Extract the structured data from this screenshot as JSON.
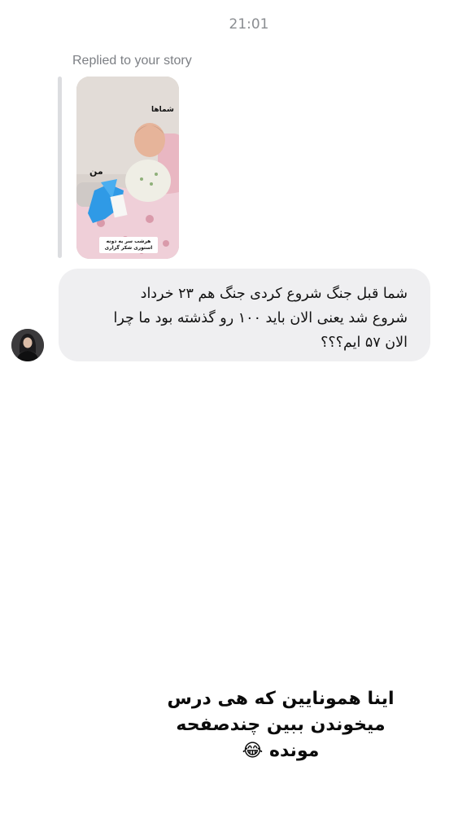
{
  "header": {
    "time": "21:01"
  },
  "story_reply": {
    "label": "Replied to your story",
    "thumbnail": {
      "top_tag": "شماها",
      "side_tag": "من",
      "caption": "هرشب سر یه دونه استوری شکر گزاری"
    }
  },
  "message": {
    "lines": [
      "شما قبل جنگ شروع کردی جنگ هم ۲۳ خرداد",
      "شروع شد یعنی الان باید ۱۰۰ رو گذشته بود ما چرا",
      "الان ۵۷ ایم؟؟؟"
    ]
  },
  "overlay_text": {
    "lines": [
      "اینا همونایین که هی درس",
      "میخوندن ببین چندصفحه",
      "مونده 😂"
    ]
  }
}
